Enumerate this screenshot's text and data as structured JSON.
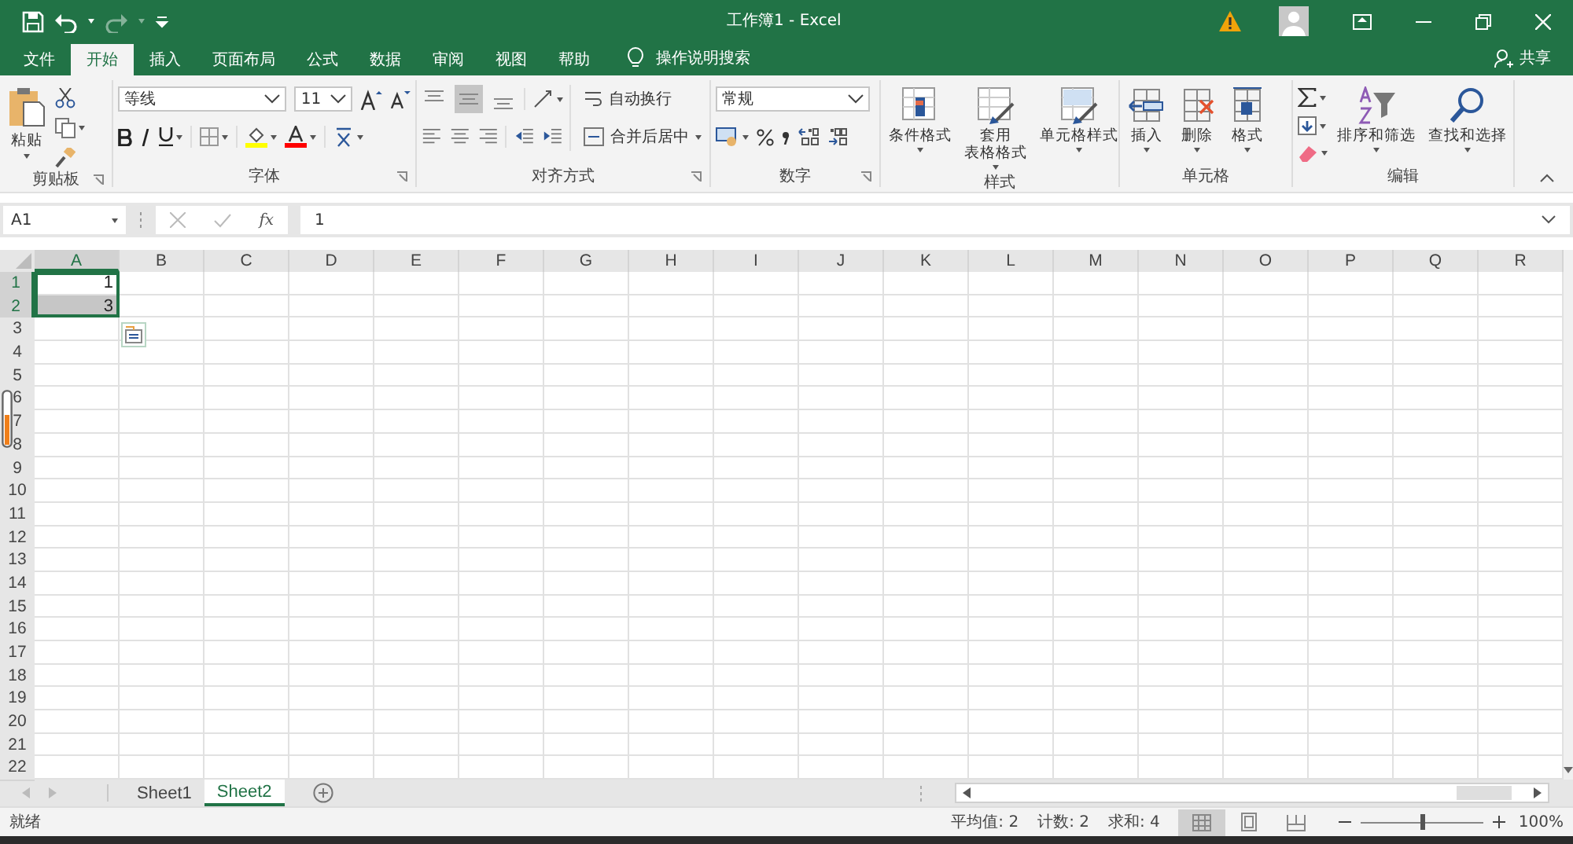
{
  "title_bar": {
    "title": "工作簿1  -  Excel"
  },
  "tabs": [
    {
      "label": "文件",
      "selected": false
    },
    {
      "label": "开始",
      "selected": true
    },
    {
      "label": "插入",
      "selected": false
    },
    {
      "label": "页面布局",
      "selected": false
    },
    {
      "label": "公式",
      "selected": false
    },
    {
      "label": "数据",
      "selected": false
    },
    {
      "label": "审阅",
      "selected": false
    },
    {
      "label": "视图",
      "selected": false
    },
    {
      "label": "帮助",
      "selected": false
    }
  ],
  "tell_me": {
    "placeholder": "操作说明搜索"
  },
  "share": "共享",
  "ribbon": {
    "clipboard": {
      "paste": "粘贴",
      "label": "剪贴板"
    },
    "font": {
      "font_name": "等线",
      "font_size": "11",
      "label": "字体"
    },
    "alignment": {
      "wrap": "自动换行",
      "merge": "合并后居中",
      "label": "对齐方式"
    },
    "number": {
      "format": "常规",
      "label": "数字"
    },
    "styles": {
      "buttons": [
        {
          "lines": [
            "条件格式"
          ]
        },
        {
          "lines": [
            "套用",
            "表格格式"
          ]
        },
        {
          "lines": [
            "单元格样式"
          ]
        }
      ],
      "label": "样式"
    },
    "cells": {
      "buttons": [
        "插入",
        "删除",
        "格式"
      ],
      "label": "单元格"
    },
    "editing": {
      "buttons": [
        "排序和筛选",
        "查找和选择"
      ],
      "label": "编辑"
    }
  },
  "formula_bar": {
    "name_box": "A1",
    "function_label": "fx",
    "value": "1"
  },
  "sheet": {
    "columns": [
      {
        "label": "A",
        "selected": true
      },
      {
        "label": "B",
        "selected": false
      },
      {
        "label": "C",
        "selected": false
      },
      {
        "label": "D",
        "selected": false
      },
      {
        "label": "E",
        "selected": false
      },
      {
        "label": "F",
        "selected": false
      },
      {
        "label": "G",
        "selected": false
      },
      {
        "label": "H",
        "selected": false
      },
      {
        "label": "I",
        "selected": false
      },
      {
        "label": "J",
        "selected": false
      },
      {
        "label": "K",
        "selected": false
      },
      {
        "label": "L",
        "selected": false
      },
      {
        "label": "M",
        "selected": false
      },
      {
        "label": "N",
        "selected": false
      },
      {
        "label": "O",
        "selected": false
      },
      {
        "label": "P",
        "selected": false
      },
      {
        "label": "Q",
        "selected": false
      },
      {
        "label": "R",
        "selected": false
      }
    ],
    "rows": [
      {
        "label": "1",
        "selected": true,
        "cells": [
          {
            "value": "1",
            "active": true
          }
        ]
      },
      {
        "label": "2",
        "selected": true,
        "cells": [
          {
            "value": "3",
            "active": false
          }
        ]
      },
      {
        "label": "3",
        "selected": false
      },
      {
        "label": "4",
        "selected": false
      },
      {
        "label": "5",
        "selected": false
      },
      {
        "label": "6",
        "selected": false
      },
      {
        "label": "7",
        "selected": false
      },
      {
        "label": "8",
        "selected": false
      },
      {
        "label": "9",
        "selected": false
      },
      {
        "label": "10",
        "selected": false
      },
      {
        "label": "11",
        "selected": false
      },
      {
        "label": "12",
        "selected": false
      },
      {
        "label": "13",
        "selected": false
      },
      {
        "label": "14",
        "selected": false
      },
      {
        "label": "15",
        "selected": false
      },
      {
        "label": "16",
        "selected": false
      },
      {
        "label": "17",
        "selected": false
      },
      {
        "label": "18",
        "selected": false
      },
      {
        "label": "19",
        "selected": false
      },
      {
        "label": "20",
        "selected": false
      },
      {
        "label": "21",
        "selected": false
      },
      {
        "label": "22",
        "selected": false
      }
    ]
  },
  "sheets": [
    {
      "label": "Sheet1",
      "selected": false
    },
    {
      "label": "Sheet2",
      "selected": true
    }
  ],
  "status_bar": {
    "mode": "就绪",
    "stats": [
      "平均值: 2",
      "计数: 2",
      "求和: 4"
    ],
    "views": [
      {
        "kind": "normal",
        "selected": true
      },
      {
        "kind": "page_layout",
        "selected": false
      },
      {
        "kind": "page_break",
        "selected": false
      }
    ],
    "zoom": {
      "level": 0.5,
      "reading": "100%"
    }
  }
}
